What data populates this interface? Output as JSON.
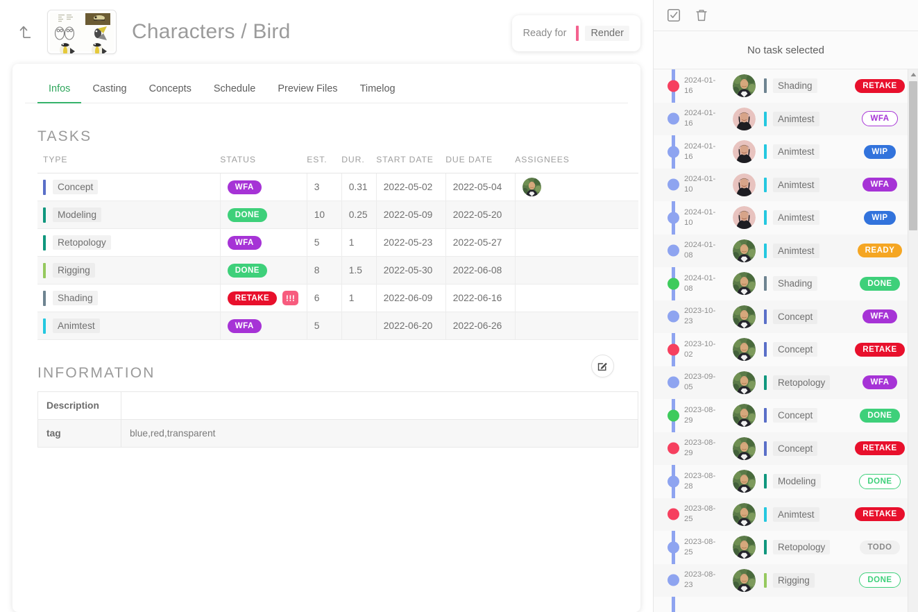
{
  "header": {
    "back_icon": "arrow-up-left-icon",
    "thumbnail_alt": "bird-concept-sheet",
    "title": "Characters / Bird",
    "ready_label": "Ready for",
    "ready_value": "Render",
    "ready_bar_color": "#f4628f"
  },
  "tabs": [
    {
      "label": "Infos",
      "active": true
    },
    {
      "label": "Casting",
      "active": false
    },
    {
      "label": "Concepts",
      "active": false
    },
    {
      "label": "Schedule",
      "active": false
    },
    {
      "label": "Preview Files",
      "active": false
    },
    {
      "label": "Timelog",
      "active": false
    }
  ],
  "tasks_section": {
    "title": "TASKS",
    "columns": [
      "TYPE",
      "STATUS",
      "EST.",
      "DUR.",
      "START DATE",
      "DUE DATE",
      "ASSIGNEES"
    ],
    "rows": [
      {
        "type": "Concept",
        "type_color": "#5a6fc8",
        "status": "WFA",
        "status_color": "#a633d6",
        "status_outline": false,
        "priority": "",
        "est": "3",
        "dur": "0.31",
        "start": "2022-05-02",
        "due": "2022-05-04",
        "assignee": true
      },
      {
        "type": "Modeling",
        "type_color": "#10977e",
        "status": "DONE",
        "status_color": "#3ed07a",
        "status_outline": false,
        "priority": "",
        "est": "10",
        "dur": "0.25",
        "start": "2022-05-09",
        "due": "2022-05-20",
        "assignee": false
      },
      {
        "type": "Retopology",
        "type_color": "#10977e",
        "status": "WFA",
        "status_color": "#a633d6",
        "status_outline": false,
        "priority": "",
        "est": "5",
        "dur": "1",
        "start": "2022-05-23",
        "due": "2022-05-27",
        "assignee": false
      },
      {
        "type": "Rigging",
        "type_color": "#96c95f",
        "status": "DONE",
        "status_color": "#3ed07a",
        "status_outline": false,
        "priority": "",
        "est": "8",
        "dur": "1.5",
        "start": "2022-05-30",
        "due": "2022-06-08",
        "assignee": false
      },
      {
        "type": "Shading",
        "type_color": "#6e8491",
        "status": "RETAKE",
        "status_color": "#e8102c",
        "status_outline": false,
        "priority": "!!!",
        "est": "6",
        "dur": "1",
        "start": "2022-06-09",
        "due": "2022-06-16",
        "assignee": false
      },
      {
        "type": "Animtest",
        "type_color": "#25c8e0",
        "status": "WFA",
        "status_color": "#a633d6",
        "status_outline": false,
        "priority": "",
        "est": "5",
        "dur": "",
        "start": "2022-06-20",
        "due": "2022-06-26",
        "assignee": false
      }
    ]
  },
  "information_section": {
    "title": "INFORMATION",
    "edit_icon": "edit-pencil-square-icon",
    "rows": [
      {
        "key": "Description",
        "value": ""
      },
      {
        "key": "tag",
        "value": "blue,red,transparent"
      }
    ]
  },
  "side_panel": {
    "toolbar": [
      {
        "icon": "checkbox-check-icon",
        "name": "select-all-button"
      },
      {
        "icon": "trash-icon",
        "name": "delete-button"
      }
    ],
    "no_selection_text": "No task selected",
    "activities": [
      {
        "date": "2024-01-16",
        "dot_color": "#f6405f",
        "avatar": "a",
        "type": "Shading",
        "type_color": "#6e8491",
        "status": "RETAKE",
        "status_color": "#e8102c",
        "outline": false
      },
      {
        "date": "2024-01-16",
        "dot_color": "#8ea4f0",
        "avatar": "b",
        "type": "Animtest",
        "type_color": "#25c8e0",
        "status": "WFA",
        "status_color": "#a633d6",
        "outline": true
      },
      {
        "date": "2024-01-16",
        "dot_color": "#8ea4f0",
        "avatar": "b",
        "type": "Animtest",
        "type_color": "#25c8e0",
        "status": "WIP",
        "status_color": "#3273dc",
        "outline": false
      },
      {
        "date": "2024-01-10",
        "dot_color": "#8ea4f0",
        "avatar": "b",
        "type": "Animtest",
        "type_color": "#25c8e0",
        "status": "WFA",
        "status_color": "#a633d6",
        "outline": false
      },
      {
        "date": "2024-01-10",
        "dot_color": "#8ea4f0",
        "avatar": "b",
        "type": "Animtest",
        "type_color": "#25c8e0",
        "status": "WIP",
        "status_color": "#3273dc",
        "outline": false
      },
      {
        "date": "2024-01-08",
        "dot_color": "#8ea4f0",
        "avatar": "a",
        "type": "Animtest",
        "type_color": "#25c8e0",
        "status": "READY",
        "status_color": "#f5a623",
        "outline": false
      },
      {
        "date": "2024-01-08",
        "dot_color": "#3ecb5c",
        "avatar": "a",
        "type": "Shading",
        "type_color": "#6e8491",
        "status": "DONE",
        "status_color": "#3ed07a",
        "outline": false
      },
      {
        "date": "2023-10-23",
        "dot_color": "#8ea4f0",
        "avatar": "a",
        "type": "Concept",
        "type_color": "#5a6fc8",
        "status": "WFA",
        "status_color": "#a633d6",
        "outline": false
      },
      {
        "date": "2023-10-02",
        "dot_color": "#f6405f",
        "avatar": "a",
        "type": "Concept",
        "type_color": "#5a6fc8",
        "status": "RETAKE",
        "status_color": "#e8102c",
        "outline": false
      },
      {
        "date": "2023-09-05",
        "dot_color": "#8ea4f0",
        "avatar": "a",
        "type": "Retopology",
        "type_color": "#10977e",
        "status": "WFA",
        "status_color": "#a633d6",
        "outline": false
      },
      {
        "date": "2023-08-29",
        "dot_color": "#3ecb5c",
        "avatar": "a",
        "type": "Concept",
        "type_color": "#5a6fc8",
        "status": "DONE",
        "status_color": "#3ed07a",
        "outline": false
      },
      {
        "date": "2023-08-29",
        "dot_color": "#f6405f",
        "avatar": "a",
        "type": "Concept",
        "type_color": "#5a6fc8",
        "status": "RETAKE",
        "status_color": "#e8102c",
        "outline": false
      },
      {
        "date": "2023-08-28",
        "dot_color": "#8ea4f0",
        "avatar": "a",
        "type": "Modeling",
        "type_color": "#10977e",
        "status": "DONE",
        "status_color": "#3ed07a",
        "outline": true
      },
      {
        "date": "2023-08-25",
        "dot_color": "#f6405f",
        "avatar": "a",
        "type": "Animtest",
        "type_color": "#25c8e0",
        "status": "RETAKE",
        "status_color": "#e8102c",
        "outline": false
      },
      {
        "date": "2023-08-25",
        "dot_color": "#8ea4f0",
        "avatar": "a",
        "type": "Retopology",
        "type_color": "#10977e",
        "status": "TODO",
        "status_color": "#999999",
        "outline": false,
        "status_bg": "#f0f0f0"
      },
      {
        "date": "2023-08-23",
        "dot_color": "#8ea4f0",
        "avatar": "a",
        "type": "Rigging",
        "type_color": "#96c95f",
        "status": "DONE",
        "status_color": "#3ed07a",
        "outline": true
      }
    ],
    "scrollbar": {
      "up_arrow": "chevron-up-icon"
    }
  }
}
